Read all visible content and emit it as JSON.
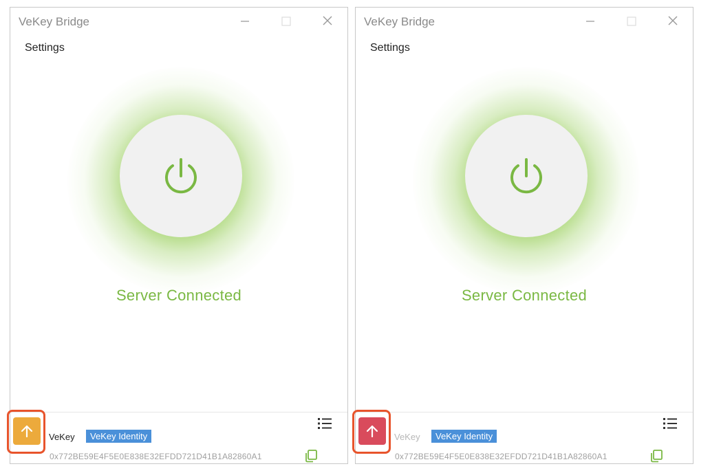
{
  "windows": [
    {
      "title": "VeKey Bridge",
      "settings_label": "Settings",
      "status": "Server Connected",
      "account_name": "VeKey",
      "identity_label": "VeKey Identity",
      "address": "0x772BE59E4F5E0E838E32EFDD721D41B1A82860A1",
      "upload_button_color": "#ecaa3c",
      "account_name_color": "#222222"
    },
    {
      "title": "VeKey Bridge",
      "settings_label": "Settings",
      "status": "Server Connected",
      "account_name": "VeKey",
      "identity_label": "VeKey Identity",
      "address": "0x772BE59E4F5E0E838E32EFDD721D41B1A82860A1",
      "upload_button_color": "#d94b5c",
      "account_name_color": "#b8b8b8"
    }
  ],
  "colors": {
    "accent_green": "#7ab843",
    "badge_blue": "#4a90d9",
    "highlight_orange": "#e8542c"
  },
  "icons": {
    "minimize": "minimize-icon",
    "maximize": "maximize-icon",
    "close": "close-icon",
    "power": "power-icon",
    "upload": "arrow-up-icon",
    "menu": "list-menu-icon",
    "copy": "copy-icon"
  }
}
